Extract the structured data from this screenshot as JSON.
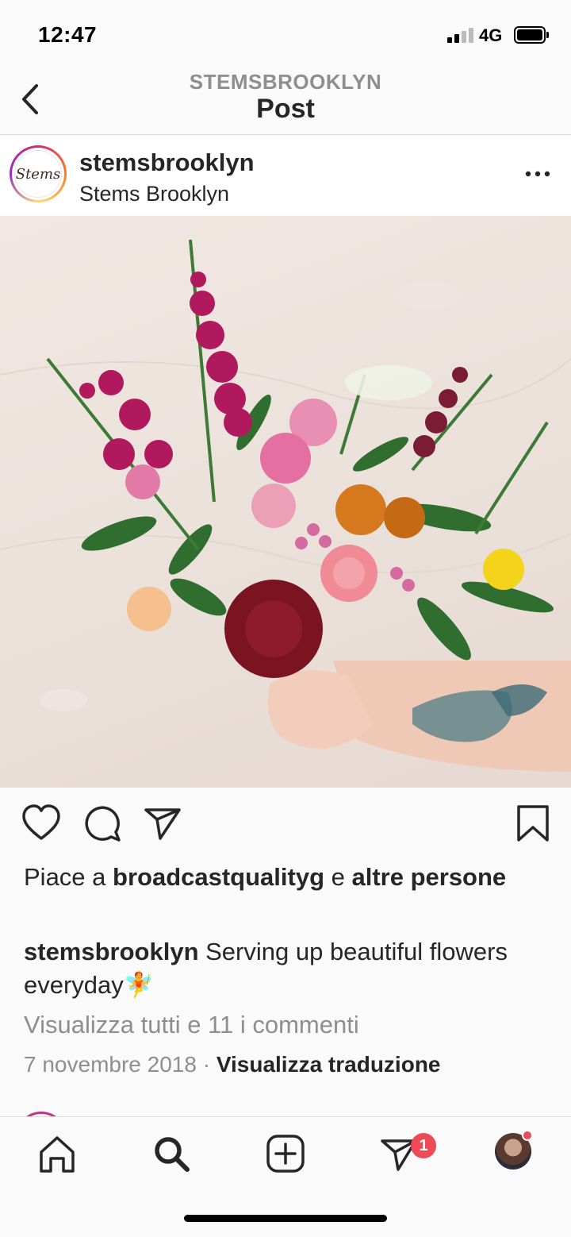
{
  "status_bar": {
    "time": "12:47",
    "network": "4G"
  },
  "header": {
    "subtitle": "STEMSBROOKLYN",
    "title": "Post"
  },
  "post": {
    "avatar_text": "Stems",
    "username": "stemsbrooklyn",
    "location": "Stems Brooklyn",
    "likes": {
      "prefix": "Piace a ",
      "user": "broadcastqualityg",
      "middle": " e ",
      "others": "altre persone"
    },
    "caption": {
      "user": "stemsbrooklyn",
      "text": " Serving up beautiful flowers everyday",
      "emoji": "🧚"
    },
    "view_comments": "Visualizza tutti e 11 i commenti",
    "date": "7 novembre 2018",
    "separator": " · ",
    "translate": "Visualizza traduzione"
  },
  "tab_bar": {
    "tabs": [
      "home-icon",
      "search-icon",
      "add-post-icon",
      "activity-icon",
      "profile-avatar"
    ],
    "activity_badge": "1"
  },
  "colors": {
    "accent_badge": "#ed4956",
    "text_primary": "#262626",
    "text_secondary": "#8e8e8e"
  }
}
